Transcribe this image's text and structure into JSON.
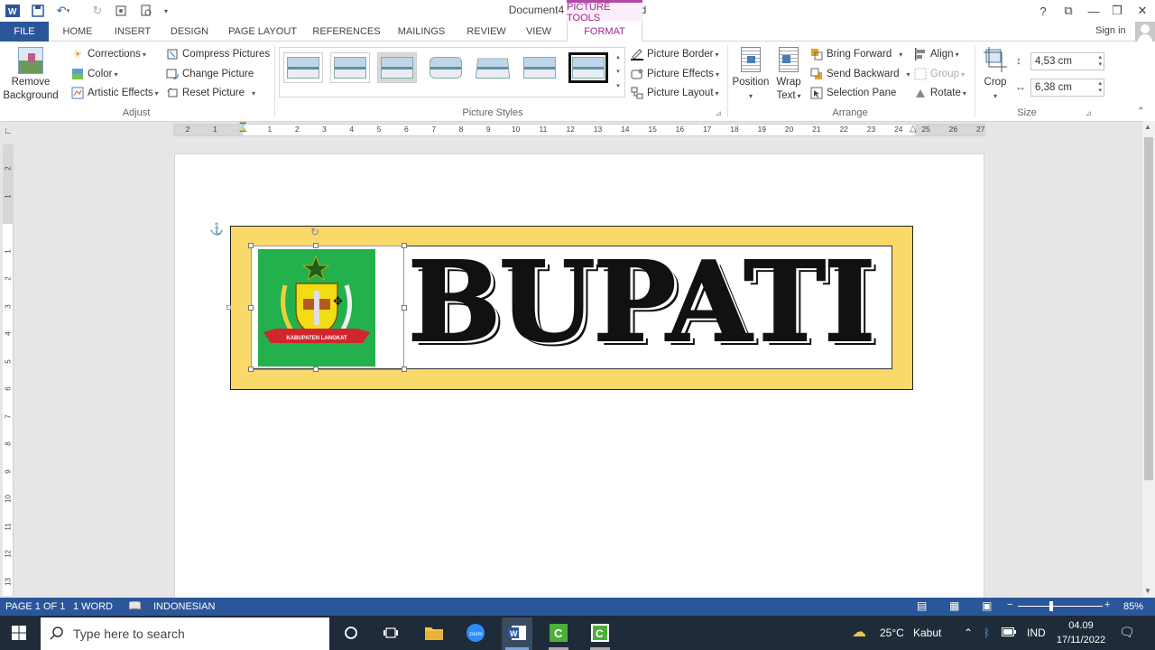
{
  "titlebar": {
    "document_title": "Document4 - Microsoft Word",
    "contextual_label": "PICTURE TOOLS",
    "help": "?",
    "restore": "⧉",
    "minimize": "—",
    "maximize": "❐",
    "close": "✕"
  },
  "tabs": {
    "file": "FILE",
    "home": "HOME",
    "insert": "INSERT",
    "design": "DESIGN",
    "page_layout": "PAGE LAYOUT",
    "references": "REFERENCES",
    "mailings": "MAILINGS",
    "review": "REVIEW",
    "view": "VIEW",
    "format": "FORMAT",
    "sign_in": "Sign in"
  },
  "ribbon": {
    "adjust": {
      "remove_background_1": "Remove",
      "remove_background_2": "Background",
      "corrections": "Corrections",
      "color": "Color",
      "artistic_effects": "Artistic Effects",
      "compress_pictures": "Compress Pictures",
      "change_picture": "Change Picture",
      "reset_picture": "Reset Picture",
      "label": "Adjust"
    },
    "picture_styles": {
      "picture_border": "Picture Border",
      "picture_effects": "Picture Effects",
      "picture_layout": "Picture Layout",
      "label": "Picture Styles"
    },
    "arrange": {
      "position": "Position",
      "wrap_text_1": "Wrap",
      "wrap_text_2": "Text",
      "bring_forward": "Bring Forward",
      "send_backward": "Send Backward",
      "selection_pane": "Selection Pane",
      "align": "Align",
      "group": "Group",
      "rotate": "Rotate",
      "label": "Arrange"
    },
    "size": {
      "crop": "Crop",
      "height": "4,53 cm",
      "width": "6,38 cm",
      "label": "Size"
    }
  },
  "ruler": {
    "h_numbers": [
      "2",
      "1",
      "1",
      "2",
      "3",
      "4",
      "5",
      "6",
      "7",
      "8",
      "9",
      "10",
      "11",
      "12",
      "13",
      "14",
      "15",
      "16",
      "17",
      "18",
      "19",
      "20",
      "21",
      "22",
      "23",
      "24",
      "25",
      "26",
      "27"
    ],
    "v_numbers": [
      "2",
      "1",
      "1",
      "2",
      "3",
      "4",
      "5",
      "6",
      "7",
      "8",
      "9",
      "10",
      "11",
      "12",
      "13"
    ]
  },
  "document": {
    "banner_text": "BUPATI",
    "logo_caption": "KABUPATEN LANGKAT"
  },
  "statusbar": {
    "page": "PAGE 1 OF 1",
    "words": "1 WORD",
    "language": "INDONESIAN",
    "zoom": "85%"
  },
  "taskbar": {
    "search_placeholder": "Type here to search",
    "weather_temp": "25°C",
    "weather_desc": "Kabut",
    "language": "IND",
    "time": "04.09",
    "date": "17/11/2022"
  }
}
